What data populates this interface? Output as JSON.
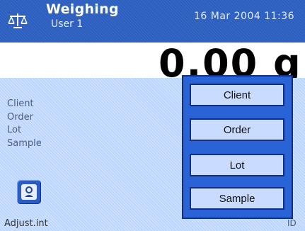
{
  "header": {
    "title": "Weighing",
    "user": "User 1",
    "datetime": "16 Mar 2004 11:36"
  },
  "weight": {
    "display": "0.00 g"
  },
  "info": {
    "labels": [
      "Client",
      "Order",
      "Lot",
      "Sample"
    ]
  },
  "footer": {
    "adjust_label": "Adjust.int",
    "right_text": "ID"
  },
  "popup": {
    "items": [
      {
        "label": "Client"
      },
      {
        "label": "Order"
      },
      {
        "label": "Lot"
      },
      {
        "label": "Sample"
      }
    ]
  },
  "icons": {
    "scale": "balance-scale-icon",
    "adjust": "weight-adjust-icon"
  },
  "colors": {
    "header_blue": "#2c5fc0",
    "panel_blue": "#bcd6ff",
    "popup_blue": "#2a63d6",
    "button_fill": "#c9dbff"
  }
}
